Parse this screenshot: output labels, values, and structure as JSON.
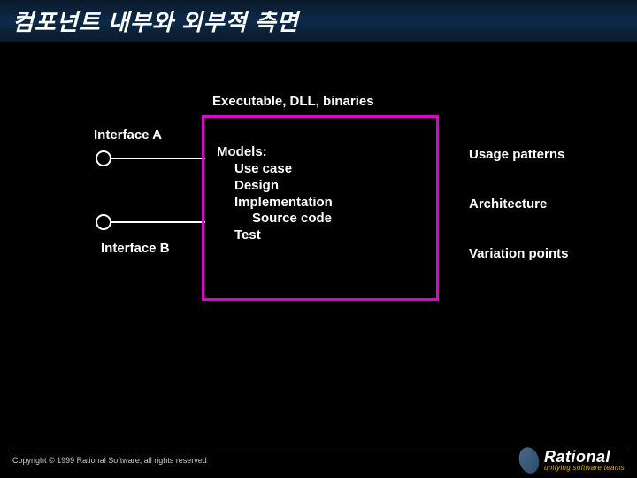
{
  "title": "컴포넌트 내부와 외부적 측면",
  "top_label": "Executable, DLL, binaries",
  "interfaces": {
    "a": "Interface A",
    "b": "Interface B"
  },
  "models": {
    "header": "Models:",
    "items": {
      "use_case": "Use case",
      "design": "Design",
      "impl": "Implementation",
      "source": "Source code",
      "test": "Test"
    }
  },
  "right": {
    "usage": "Usage patterns",
    "arch": "Architecture",
    "variation": "Variation points"
  },
  "footer": {
    "copyright": "Copyright © 1999 Rational Software, all rights reserved",
    "brand": "Rational",
    "tagline": "unifying software teams"
  }
}
